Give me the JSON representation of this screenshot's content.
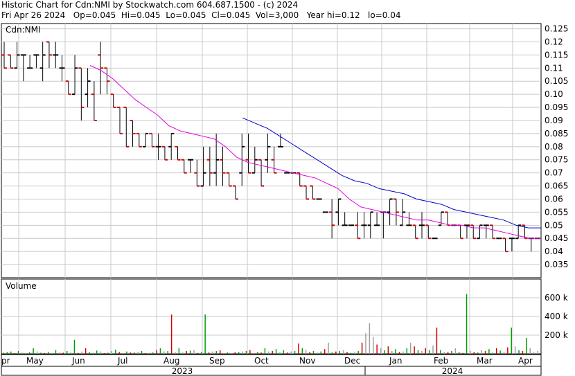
{
  "header": {
    "line1": "Historic Chart for Cdn:NMI by Stockwatch.com 604.687.1500 - (c) 2024",
    "line2": "Fri Apr 26 2024   Op=0.045  Hi=0.045  Lo=0.045  Cl=0.045  Vol=3,000   Year hi=0.12   lo=0.04"
  },
  "colors": {
    "up": "#000000",
    "down": "#d00000",
    "ma_short": "#e000e0",
    "ma_long": "#0000c8",
    "vol_up": "#00a000",
    "vol_down": "#d00000",
    "vol_flat": "#a0a0a0",
    "grid": "#c8c8c8"
  },
  "chart_data": [
    {
      "type": "line",
      "title": "Cdn:NMI",
      "ylim": [
        0.03,
        0.127
      ],
      "yticks": [
        "0.125",
        "0.12",
        "0.115",
        "0.11",
        "0.105",
        "0.10",
        "0.095",
        "0.09",
        "0.085",
        "0.08",
        "0.075",
        "0.07",
        "0.065",
        "0.06",
        "0.055",
        "0.05",
        "0.045",
        "0.04",
        "0.035"
      ],
      "ytick_values": [
        0.125,
        0.12,
        0.115,
        0.11,
        0.105,
        0.1,
        0.095,
        0.09,
        0.085,
        0.08,
        0.075,
        0.07,
        0.065,
        0.06,
        0.055,
        0.05,
        0.045,
        0.04,
        0.035
      ],
      "x_months": [
        "Apr",
        "May",
        "Jun",
        "Jul",
        "Aug",
        "Sep",
        "Oct",
        "Nov",
        "Dec",
        "Jan",
        "Feb",
        "Mar",
        "Apr"
      ],
      "years": [
        "2023",
        "2024"
      ],
      "price_bars": [
        {
          "o": 0.115,
          "c": 0.11,
          "h": 0.12,
          "l": 0.11
        },
        {
          "o": 0.115,
          "c": 0.11,
          "h": 0.115,
          "l": 0.11
        },
        {
          "o": 0.11,
          "c": 0.115,
          "h": 0.12,
          "l": 0.11
        },
        {
          "o": 0.115,
          "c": 0.115,
          "h": 0.115,
          "l": 0.105
        },
        {
          "o": 0.11,
          "c": 0.11,
          "h": 0.115,
          "l": 0.11
        },
        {
          "o": 0.115,
          "c": 0.115,
          "h": 0.115,
          "l": 0.11
        },
        {
          "o": 0.11,
          "c": 0.115,
          "h": 0.12,
          "l": 0.105
        },
        {
          "o": 0.12,
          "c": 0.115,
          "h": 0.12,
          "l": 0.11
        },
        {
          "o": 0.115,
          "c": 0.115,
          "h": 0.12,
          "l": 0.11
        },
        {
          "o": 0.11,
          "c": 0.11,
          "h": 0.115,
          "l": 0.105
        },
        {
          "o": 0.105,
          "c": 0.1,
          "h": 0.105,
          "l": 0.1
        },
        {
          "o": 0.1,
          "c": 0.11,
          "h": 0.115,
          "l": 0.1
        },
        {
          "o": 0.11,
          "c": 0.095,
          "h": 0.11,
          "l": 0.09
        },
        {
          "o": 0.1,
          "c": 0.105,
          "h": 0.11,
          "l": 0.095
        },
        {
          "o": 0.1,
          "c": 0.09,
          "h": 0.105,
          "l": 0.09
        },
        {
          "o": 0.115,
          "c": 0.11,
          "h": 0.12,
          "l": 0.1
        },
        {
          "o": 0.11,
          "c": 0.105,
          "h": 0.11,
          "l": 0.1
        },
        {
          "o": 0.1,
          "c": 0.095,
          "h": 0.1,
          "l": 0.095
        },
        {
          "o": 0.095,
          "c": 0.085,
          "h": 0.095,
          "l": 0.085
        },
        {
          "o": 0.095,
          "c": 0.08,
          "h": 0.095,
          "l": 0.08
        },
        {
          "o": 0.09,
          "c": 0.085,
          "h": 0.09,
          "l": 0.08
        },
        {
          "o": 0.085,
          "c": 0.08,
          "h": 0.085,
          "l": 0.08
        },
        {
          "o": 0.08,
          "c": 0.085,
          "h": 0.085,
          "l": 0.08
        },
        {
          "o": 0.085,
          "c": 0.08,
          "h": 0.085,
          "l": 0.08
        },
        {
          "o": 0.08,
          "c": 0.08,
          "h": 0.085,
          "l": 0.075
        },
        {
          "o": 0.08,
          "c": 0.075,
          "h": 0.08,
          "l": 0.075
        },
        {
          "o": 0.08,
          "c": 0.085,
          "h": 0.085,
          "l": 0.075
        },
        {
          "o": 0.08,
          "c": 0.075,
          "h": 0.08,
          "l": 0.075
        },
        {
          "o": 0.075,
          "c": 0.07,
          "h": 0.075,
          "l": 0.07
        },
        {
          "o": 0.075,
          "c": 0.075,
          "h": 0.075,
          "l": 0.07
        },
        {
          "o": 0.07,
          "c": 0.065,
          "h": 0.075,
          "l": 0.065
        },
        {
          "o": 0.065,
          "c": 0.07,
          "h": 0.08,
          "l": 0.065
        },
        {
          "o": 0.075,
          "c": 0.07,
          "h": 0.08,
          "l": 0.065
        },
        {
          "o": 0.07,
          "c": 0.075,
          "h": 0.085,
          "l": 0.065
        },
        {
          "o": 0.075,
          "c": 0.07,
          "h": 0.08,
          "l": 0.065
        },
        {
          "o": 0.07,
          "c": 0.065,
          "h": 0.07,
          "l": 0.065
        },
        {
          "o": 0.065,
          "c": 0.06,
          "h": 0.065,
          "l": 0.06
        },
        {
          "o": 0.07,
          "c": 0.08,
          "h": 0.085,
          "l": 0.065
        },
        {
          "o": 0.075,
          "c": 0.07,
          "h": 0.085,
          "l": 0.07
        },
        {
          "o": 0.07,
          "c": 0.075,
          "h": 0.08,
          "l": 0.07
        },
        {
          "o": 0.075,
          "c": 0.065,
          "h": 0.075,
          "l": 0.065
        },
        {
          "o": 0.075,
          "c": 0.08,
          "h": 0.085,
          "l": 0.07
        },
        {
          "o": 0.075,
          "c": 0.07,
          "h": 0.08,
          "l": 0.07
        },
        {
          "o": 0.08,
          "c": 0.08,
          "h": 0.085,
          "l": 0.08
        },
        {
          "o": 0.07,
          "c": 0.07,
          "h": 0.07,
          "l": 0.07
        },
        {
          "o": 0.07,
          "c": 0.07,
          "h": 0.07,
          "l": 0.07
        },
        {
          "o": 0.07,
          "c": 0.065,
          "h": 0.07,
          "l": 0.065
        },
        {
          "o": 0.065,
          "c": 0.06,
          "h": 0.065,
          "l": 0.06
        },
        {
          "o": 0.065,
          "c": 0.06,
          "h": 0.065,
          "l": 0.06
        },
        {
          "o": 0.06,
          "c": 0.06,
          "h": 0.06,
          "l": 0.06
        },
        {
          "o": 0.055,
          "c": 0.055,
          "h": 0.055,
          "l": 0.055
        },
        {
          "o": 0.055,
          "c": 0.05,
          "h": 0.06,
          "l": 0.045
        },
        {
          "o": 0.055,
          "c": 0.06,
          "h": 0.06,
          "l": 0.05
        },
        {
          "o": 0.05,
          "c": 0.05,
          "h": 0.055,
          "l": 0.05
        },
        {
          "o": 0.05,
          "c": 0.05,
          "h": 0.05,
          "l": 0.05
        },
        {
          "o": 0.05,
          "c": 0.045,
          "h": 0.055,
          "l": 0.045
        },
        {
          "o": 0.05,
          "c": 0.05,
          "h": 0.055,
          "l": 0.045
        },
        {
          "o": 0.05,
          "c": 0.055,
          "h": 0.055,
          "l": 0.045
        },
        {
          "o": 0.05,
          "c": 0.05,
          "h": 0.055,
          "l": 0.05
        },
        {
          "o": 0.055,
          "c": 0.055,
          "h": 0.055,
          "l": 0.045
        },
        {
          "o": 0.055,
          "c": 0.06,
          "h": 0.06,
          "l": 0.05
        },
        {
          "o": 0.06,
          "c": 0.055,
          "h": 0.06,
          "l": 0.05
        },
        {
          "o": 0.05,
          "c": 0.055,
          "h": 0.06,
          "l": 0.05
        },
        {
          "o": 0.05,
          "c": 0.05,
          "h": 0.055,
          "l": 0.05
        },
        {
          "o": 0.05,
          "c": 0.045,
          "h": 0.05,
          "l": 0.045
        },
        {
          "o": 0.05,
          "c": 0.05,
          "h": 0.055,
          "l": 0.045
        },
        {
          "o": 0.05,
          "c": 0.045,
          "h": 0.05,
          "l": 0.045
        },
        {
          "o": 0.045,
          "c": 0.045,
          "h": 0.045,
          "l": 0.045
        },
        {
          "o": 0.05,
          "c": 0.055,
          "h": 0.055,
          "l": 0.05
        },
        {
          "o": 0.055,
          "c": 0.05,
          "h": 0.055,
          "l": 0.05
        },
        {
          "o": 0.05,
          "c": 0.05,
          "h": 0.05,
          "l": 0.05
        },
        {
          "o": 0.05,
          "c": 0.045,
          "h": 0.05,
          "l": 0.045
        },
        {
          "o": 0.05,
          "c": 0.05,
          "h": 0.05,
          "l": 0.045
        },
        {
          "o": 0.05,
          "c": 0.045,
          "h": 0.05,
          "l": 0.045
        },
        {
          "o": 0.045,
          "c": 0.05,
          "h": 0.05,
          "l": 0.045
        },
        {
          "o": 0.05,
          "c": 0.05,
          "h": 0.05,
          "l": 0.045
        },
        {
          "o": 0.05,
          "c": 0.045,
          "h": 0.05,
          "l": 0.045
        },
        {
          "o": 0.045,
          "c": 0.045,
          "h": 0.045,
          "l": 0.045
        },
        {
          "o": 0.045,
          "c": 0.04,
          "h": 0.045,
          "l": 0.04
        },
        {
          "o": 0.045,
          "c": 0.045,
          "h": 0.045,
          "l": 0.04
        },
        {
          "o": 0.045,
          "c": 0.05,
          "h": 0.05,
          "l": 0.045
        },
        {
          "o": 0.05,
          "c": 0.045,
          "h": 0.05,
          "l": 0.045
        },
        {
          "o": 0.045,
          "c": 0.045,
          "h": 0.045,
          "l": 0.04
        },
        {
          "o": 0.045,
          "c": 0.045,
          "h": 0.045,
          "l": 0.045
        }
      ],
      "ma_short": [
        0.111,
        0.109,
        0.106,
        0.102,
        0.098,
        0.095,
        0.092,
        0.088,
        0.086,
        0.085,
        0.084,
        0.083,
        0.08,
        0.076,
        0.074,
        0.073,
        0.072,
        0.071,
        0.07,
        0.069,
        0.068,
        0.066,
        0.064,
        0.06,
        0.057,
        0.056,
        0.055,
        0.054,
        0.053,
        0.052,
        0.052,
        0.051,
        0.05,
        0.05,
        0.049,
        0.049,
        0.048,
        0.047,
        0.046,
        0.045,
        0.045
      ],
      "ma_long": [
        0.091,
        0.089,
        0.087,
        0.084,
        0.081,
        0.078,
        0.075,
        0.072,
        0.069,
        0.067,
        0.066,
        0.064,
        0.063,
        0.062,
        0.06,
        0.059,
        0.058,
        0.056,
        0.055,
        0.054,
        0.053,
        0.052,
        0.05,
        0.049,
        0.049
      ]
    },
    {
      "type": "bar",
      "title": "Volume",
      "ylim": [
        0,
        800
      ],
      "yticks": [
        "600 k",
        "400 k",
        "200 k"
      ],
      "ytick_values": [
        600,
        400,
        200
      ],
      "values": [
        12,
        20,
        25,
        8,
        30,
        15,
        10,
        18,
        60,
        25,
        12,
        8,
        20,
        10,
        40,
        15,
        12,
        30,
        18,
        150,
        10,
        25,
        60,
        20,
        15,
        35,
        25,
        8,
        12,
        30,
        45,
        20,
        10,
        25,
        15,
        18,
        22,
        30,
        8,
        12,
        15,
        40,
        60,
        25,
        30,
        420,
        20,
        60,
        15,
        30,
        35,
        40,
        10,
        20,
        420,
        15,
        25,
        30,
        40,
        8,
        15,
        10,
        18,
        20,
        25,
        30,
        40,
        10,
        20,
        15,
        60,
        25,
        30,
        50,
        20,
        40,
        15,
        25,
        30,
        110,
        60,
        40,
        20,
        30,
        15,
        25,
        50,
        120,
        15,
        25,
        30,
        40,
        20,
        10,
        15,
        30,
        120,
        220,
        330,
        180,
        100,
        60,
        40,
        80,
        30,
        50,
        20,
        25,
        60,
        120,
        80,
        40,
        30,
        60,
        40,
        90,
        280,
        40,
        20,
        20,
        30,
        60,
        20,
        10,
        640,
        30,
        20,
        15,
        40,
        30,
        50,
        20,
        60,
        35,
        20,
        70,
        280,
        80,
        40,
        30,
        170,
        60,
        20,
        30
      ],
      "colors": [
        "u",
        "u",
        "u",
        "d",
        "u",
        "f",
        "f",
        "u",
        "u",
        "f",
        "u",
        "d",
        "u",
        "f",
        "u",
        "f",
        "d",
        "u",
        "f",
        "u",
        "d",
        "f",
        "d",
        "u",
        "f",
        "u",
        "f",
        "d",
        "u",
        "f",
        "u",
        "d",
        "f",
        "u",
        "d",
        "u",
        "f",
        "u",
        "d",
        "f",
        "u",
        "d",
        "u",
        "f",
        "u",
        "d",
        "f",
        "u",
        "f",
        "d",
        "u",
        "f",
        "d",
        "u",
        "u",
        "d",
        "f",
        "u",
        "d",
        "f",
        "u",
        "f",
        "d",
        "u",
        "f",
        "u",
        "d",
        "f",
        "u",
        "d",
        "u",
        "f",
        "d",
        "u",
        "f",
        "u",
        "d",
        "f",
        "u",
        "d",
        "u",
        "f",
        "d",
        "u",
        "f",
        "u",
        "d",
        "f",
        "u",
        "d",
        "u",
        "f",
        "d",
        "u",
        "f",
        "u",
        "d",
        "f",
        "f",
        "f",
        "d",
        "f",
        "u",
        "d",
        "f",
        "u",
        "d",
        "f",
        "u",
        "f",
        "d",
        "u",
        "f",
        "d",
        "u",
        "f",
        "d",
        "u",
        "f",
        "d",
        "u",
        "f",
        "u",
        "d",
        "u",
        "f",
        "d",
        "u",
        "f",
        "d",
        "u",
        "f",
        "d",
        "u",
        "f",
        "d",
        "u",
        "f",
        "u",
        "d",
        "u",
        "f"
      ]
    }
  ]
}
